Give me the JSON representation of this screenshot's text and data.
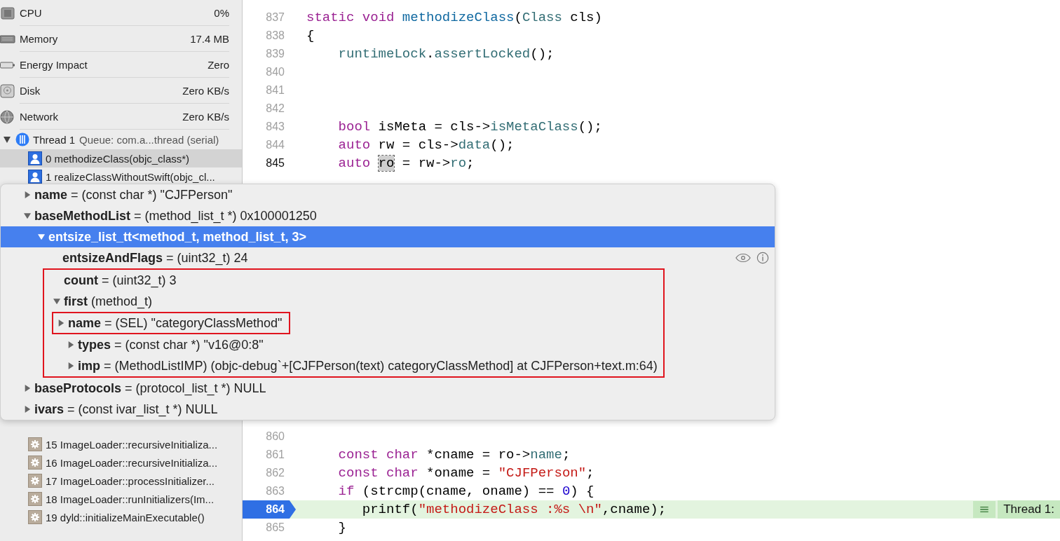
{
  "gauges": [
    {
      "kind": "cpu",
      "label": "CPU",
      "value": "0%"
    },
    {
      "kind": "memory",
      "label": "Memory",
      "value": "17.4 MB"
    },
    {
      "kind": "energy",
      "label": "Energy Impact",
      "value": "Zero"
    },
    {
      "kind": "disk",
      "label": "Disk",
      "value": "Zero KB/s"
    },
    {
      "kind": "network",
      "label": "Network",
      "value": "Zero KB/s"
    }
  ],
  "thread": {
    "name": "Thread 1",
    "queue": "Queue: com.a...thread (serial)",
    "expanded": true
  },
  "frame_groups": [
    [
      {
        "kind": "user",
        "label": "0 methodizeClass(objc_class*)",
        "selected": true
      },
      {
        "kind": "user",
        "label": "1 realizeClassWithoutSwift(objc_cl...",
        "selected": false
      }
    ],
    [
      {
        "kind": "system",
        "label": "15 ImageLoader::recursiveInitializa...",
        "selected": false
      },
      {
        "kind": "system",
        "label": "16 ImageLoader::recursiveInitializa...",
        "selected": false
      },
      {
        "kind": "system",
        "label": "17 ImageLoader::processInitializer...",
        "selected": false
      },
      {
        "kind": "system",
        "label": "18 ImageLoader::runInitializers(Im...",
        "selected": false
      },
      {
        "kind": "system",
        "label": "19 dyld::initializeMainExecutable()",
        "selected": false
      }
    ]
  ],
  "code_blocks": [
    {
      "lines": [
        {
          "number": "837",
          "current": false,
          "cursor": false,
          "tokens": [
            {
              "kind": "kw",
              "text": "static"
            },
            {
              "kind": "kw",
              "text": " void"
            },
            {
              "kind": "fn",
              "text": " methodizeClass"
            },
            {
              "kind": "plain",
              "text": "("
            },
            {
              "kind": "type",
              "text": "Class"
            },
            {
              "kind": "plain",
              "text": " cls)"
            }
          ]
        },
        {
          "number": "838",
          "current": false,
          "cursor": false,
          "tokens": [
            {
              "kind": "plain",
              "text": "{"
            }
          ]
        },
        {
          "number": "839",
          "current": false,
          "cursor": false,
          "tokens": [
            {
              "kind": "type",
              "text": "    runtimeLock"
            },
            {
              "kind": "plain",
              "text": "."
            },
            {
              "kind": "type",
              "text": "assertLocked"
            },
            {
              "kind": "plain",
              "text": "();"
            }
          ]
        },
        {
          "number": "840",
          "current": false,
          "cursor": false
        },
        {
          "number": "841",
          "current": false,
          "cursor": false
        },
        {
          "number": "842",
          "current": false,
          "cursor": false
        },
        {
          "number": "843",
          "current": false,
          "cursor": false,
          "tokens": [
            {
              "kind": "kw",
              "text": "    bool"
            },
            {
              "kind": "plain",
              "text": " isMeta = cls->"
            },
            {
              "kind": "type",
              "text": "isMetaClass"
            },
            {
              "kind": "plain",
              "text": "();"
            }
          ]
        },
        {
          "number": "844",
          "current": false,
          "cursor": false,
          "tokens": [
            {
              "kind": "kw",
              "text": "    auto"
            },
            {
              "kind": "plain",
              "text": " rw = cls->"
            },
            {
              "kind": "type",
              "text": "data"
            },
            {
              "kind": "plain",
              "text": "();"
            }
          ]
        },
        {
          "number": "845",
          "current": false,
          "cursor": true,
          "tokens": [
            {
              "kind": "kw",
              "text": "    auto "
            },
            {
              "kind": "hl",
              "text": "ro"
            },
            {
              "kind": "plain",
              "text": " = rw->"
            },
            {
              "kind": "type",
              "text": "ro"
            },
            {
              "kind": "plain",
              "text": ";"
            }
          ]
        }
      ]
    },
    {
      "lines": [
        {
          "number": "860",
          "current": false,
          "cursor": false
        },
        {
          "number": "861",
          "current": false,
          "cursor": false,
          "tokens": [
            {
              "kind": "kw",
              "text": "    const"
            },
            {
              "kind": "kw",
              "text": " char"
            },
            {
              "kind": "plain",
              "text": " *cname = ro->"
            },
            {
              "kind": "type",
              "text": "name"
            },
            {
              "kind": "plain",
              "text": ";"
            }
          ]
        },
        {
          "number": "862",
          "current": false,
          "cursor": false,
          "tokens": [
            {
              "kind": "kw",
              "text": "    const"
            },
            {
              "kind": "kw",
              "text": " char"
            },
            {
              "kind": "plain",
              "text": " *oname = "
            },
            {
              "kind": "str",
              "text": "\"CJFPerson\""
            },
            {
              "kind": "plain",
              "text": ";"
            }
          ]
        },
        {
          "number": "863",
          "current": false,
          "cursor": false,
          "tokens": [
            {
              "kind": "kw",
              "text": "    if"
            },
            {
              "kind": "plain",
              "text": " (strcmp(cname, oname) == "
            },
            {
              "kind": "num",
              "text": "0"
            },
            {
              "kind": "plain",
              "text": ") {"
            }
          ]
        },
        {
          "number": "864",
          "current": true,
          "cursor": false,
          "tokens": [
            {
              "kind": "plain",
              "text": "       printf("
            },
            {
              "kind": "str",
              "text": "\"methodizeClass :%s \\n\""
            },
            {
              "kind": "plain",
              "text": ",cname);"
            }
          ]
        },
        {
          "number": "865",
          "current": false,
          "cursor": false,
          "tokens": [
            {
              "kind": "plain",
              "text": "    }"
            }
          ]
        }
      ]
    }
  ],
  "current_line_badge": {
    "label": "Thread 1:"
  },
  "variables_popover": {
    "rows": [
      {
        "text": "**name** = (const char *) \"CJFPerson\"",
        "expandable": true,
        "expanded": false,
        "selected": false
      },
      {
        "text": "**baseMethodList** = (method_list_t *) 0x100001250",
        "expandable": true,
        "expanded": true,
        "selected": false,
        "children": [
          {
            "text": "**entsize_list_tt<method_t, method_list_t, 3>**",
            "expandable": true,
            "expanded": true,
            "selected": true,
            "children": [
              {
                "text": "**entsizeAndFlags** = (uint32_t) 24",
                "expandable": false,
                "selected": false,
                "actions": true
              },
              {
                "text": "**count** = (uint32_t) 3",
                "expandable": false,
                "selected": false,
                "frame_start": true
              },
              {
                "text": "**first** (method_t)",
                "expandable": true,
                "expanded": true,
                "selected": false,
                "children": [
                  {
                    "text": "**name** = (SEL) \"categoryClassMethod\"",
                    "expandable": true,
                    "expanded": false,
                    "selected": false,
                    "framed": true
                  },
                  {
                    "text": "**types** = (const char *) \"v16@0:8\"",
                    "expandable": true,
                    "expanded": false,
                    "selected": false
                  },
                  {
                    "text": "**imp** = (MethodListIMP) (objc-debug`+[CJFPerson(text) categoryClassMethod] at CJFPerson+text.m:64)",
                    "expandable": true,
                    "expanded": false,
                    "selected": false,
                    "frame_end": true
                  }
                ]
              }
            ]
          }
        ]
      },
      {
        "text": "**baseProtocols** = (protocol_list_t *) NULL",
        "expandable": true,
        "expanded": false,
        "selected": false
      },
      {
        "text": "**ivars** = (const ivar_list_t *) NULL",
        "expandable": true,
        "expanded": false,
        "selected": false
      }
    ]
  }
}
